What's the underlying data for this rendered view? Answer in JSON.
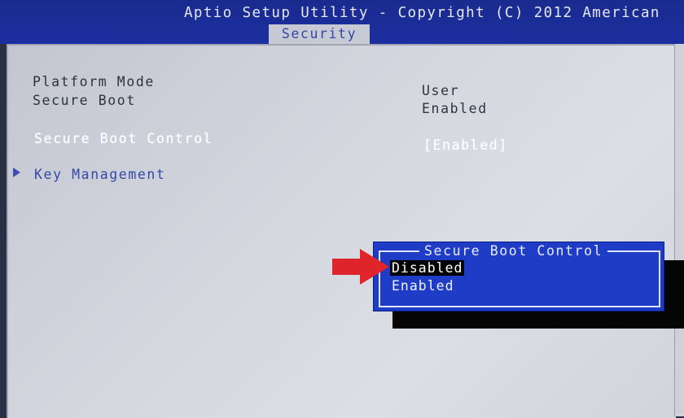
{
  "header": {
    "title": "Aptio Setup Utility - Copyright (C) 2012 American",
    "active_tab": "Security"
  },
  "settings": {
    "platform_mode": {
      "label": "Platform Mode",
      "value": "User"
    },
    "secure_boot": {
      "label": "Secure Boot",
      "value": "Enabled"
    },
    "secure_boot_control": {
      "label": "Secure Boot Control",
      "value": "[Enabled]"
    },
    "key_management": {
      "label": "Key Management"
    }
  },
  "popup": {
    "title": "Secure Boot Control",
    "options": [
      "Disabled",
      "Enabled"
    ],
    "selected_index": 0
  },
  "colors": {
    "header_blue": "#1b2fa0",
    "popup_blue": "#1e3cc6",
    "annotation_arrow": "#e0242b"
  },
  "icons": {
    "submenu_marker": "triangle-right-icon",
    "annotation": "red-arrow-icon"
  }
}
